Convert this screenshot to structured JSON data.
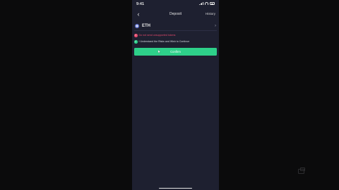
{
  "status_bar": {
    "time": "9:41"
  },
  "nav": {
    "title": "Deposit",
    "history_label": "History",
    "back_icon": "chevron-left-icon"
  },
  "coin": {
    "symbol": "ETH",
    "icon": "eth-icon",
    "chevron": "chevron-right-icon"
  },
  "notices": [
    {
      "text": "Do not send unsupported tokens",
      "status": "warning",
      "color": "#e3486b",
      "icon": "x-circle-icon"
    },
    {
      "text": "I Understand the Risks and Wish to Continue",
      "status": "confirmed",
      "color": "#2ed08a",
      "icon": "check-circle-icon"
    }
  ],
  "confirm_button": {
    "label": "Confirm",
    "color": "#2ed08a"
  },
  "colors": {
    "background": "#0b0b0c",
    "screen": "#1e2030",
    "accent": "#2ed08a",
    "danger": "#e3486b"
  }
}
